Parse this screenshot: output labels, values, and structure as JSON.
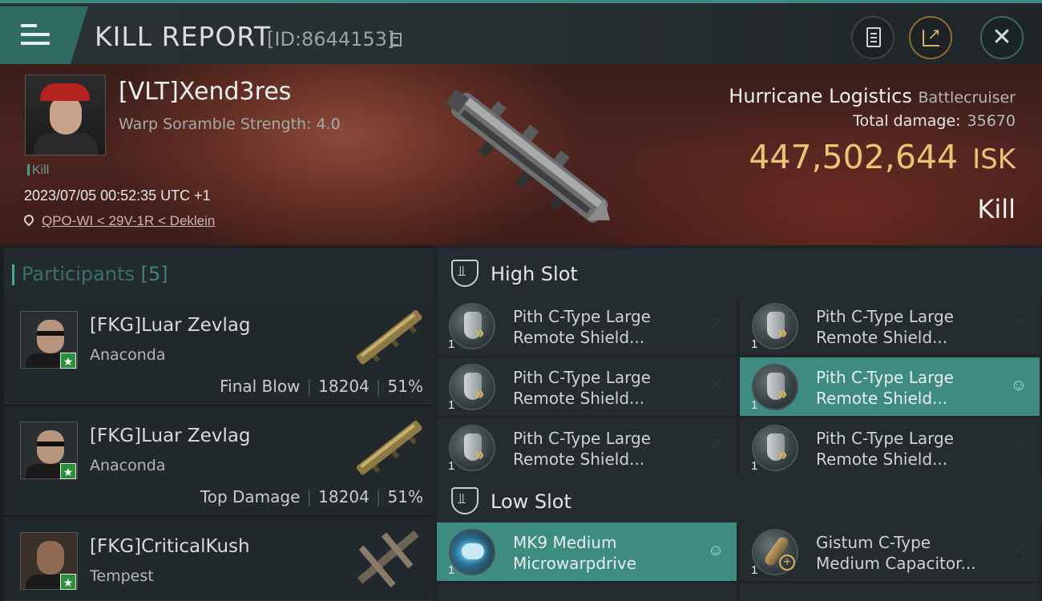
{
  "header": {
    "title": "KILL REPORT",
    "report_id": "[ID:8644153]"
  },
  "victim": {
    "name": "[VLT]Xend3res",
    "subtitle": "Warp Soramble Strength: 4.0",
    "kill_tag": "Kill",
    "datetime": "2023/07/05 00:52:35 UTC +1",
    "location": "QPO-WI < 29V-1R < Deklein",
    "ship_name": "Hurricane Logistics",
    "ship_class": "Battlecruiser",
    "total_damage_label": "Total damage:",
    "total_damage": "35670",
    "isk_value": "447,502,644",
    "isk_unit": "ISK",
    "result": "Kill"
  },
  "participants": {
    "title": "Participants",
    "count": "[5]",
    "rows": [
      {
        "name": "[FKG]Luar Zevlag",
        "ship": "Anaconda",
        "label": "Final Blow",
        "damage": "18204",
        "percent": "51%"
      },
      {
        "name": "[FKG]Luar Zevlag",
        "ship": "Anaconda",
        "label": "Top Damage",
        "damage": "18204",
        "percent": "51%"
      },
      {
        "name": "[FKG]CriticalKush",
        "ship": "Tempest"
      }
    ]
  },
  "slots": {
    "high": {
      "title": "High Slot",
      "modules": [
        {
          "line1": "Pith C-Type Large",
          "line2": "Remote Shield...",
          "qty": "1",
          "status": "destroyed"
        },
        {
          "line1": "Pith C-Type Large",
          "line2": "Remote Shield...",
          "qty": "1",
          "status": "destroyed"
        },
        {
          "line1": "Pith C-Type Large",
          "line2": "Remote Shield...",
          "qty": "1",
          "status": "destroyed"
        },
        {
          "line1": "Pith C-Type Large",
          "line2": "Remote Shield...",
          "qty": "1",
          "status": "dropped"
        },
        {
          "line1": "Pith C-Type Large",
          "line2": "Remote Shield...",
          "qty": "1",
          "status": "destroyed"
        },
        {
          "line1": "Pith C-Type Large",
          "line2": "Remote Shield...",
          "qty": "1",
          "status": "destroyed"
        }
      ]
    },
    "low": {
      "title": "Low Slot",
      "modules": [
        {
          "line1": "MK9 Medium",
          "line2": "Microwarpdrive",
          "qty": "1",
          "status": "dropped"
        },
        {
          "line1": "Gistum C-Type",
          "line2": "Medium Capacitor...",
          "qty": "1",
          "status": "destroyed"
        }
      ]
    }
  },
  "icons": {
    "destroyed": "✕",
    "dropped": "☺"
  },
  "colors": {
    "accent": "#3e8b81",
    "isk": "#e8c575",
    "corp_badge": "#2b8f3c"
  }
}
